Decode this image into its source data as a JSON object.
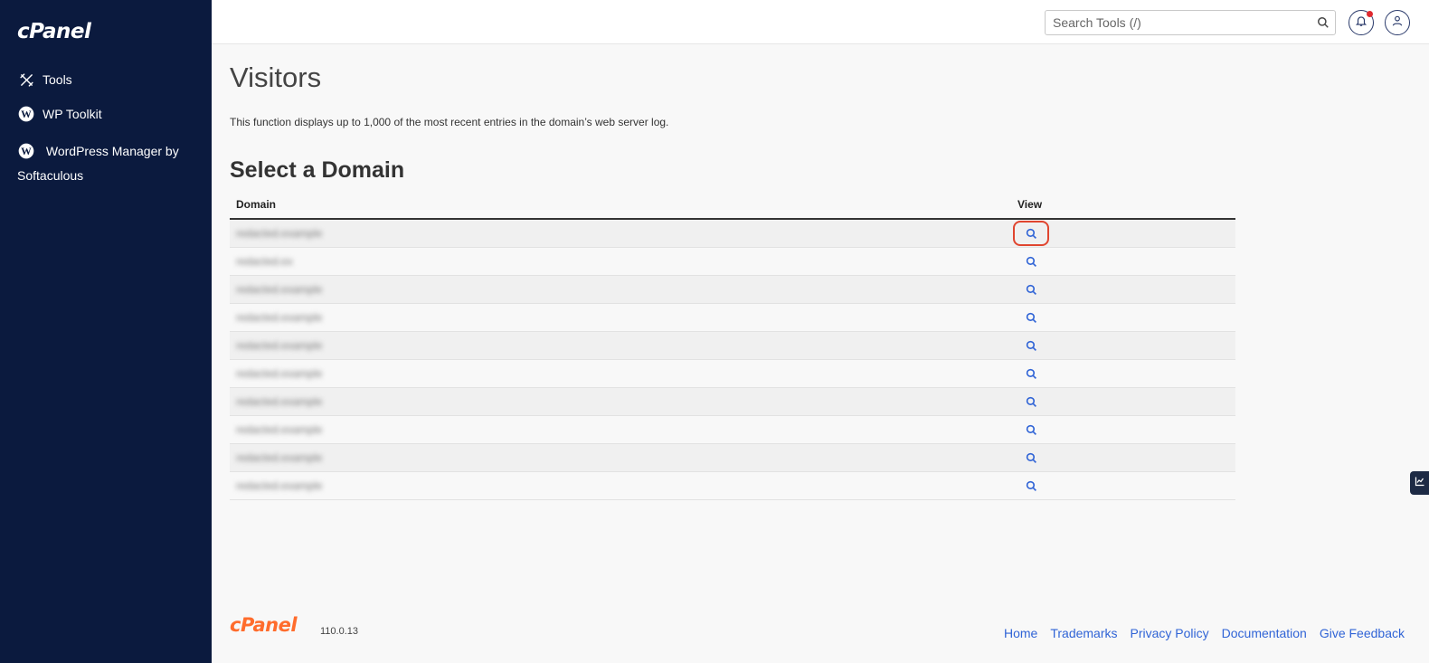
{
  "brand": {
    "logo_text": "cPanel",
    "version": "110.0.13"
  },
  "sidebar": {
    "items": [
      {
        "label": "Tools",
        "icon": "tools-icon"
      },
      {
        "label": "WP Toolkit",
        "icon": "wordpress-icon"
      },
      {
        "label": "WordPress Manager by Softaculous",
        "icon": "wordpress-icon"
      }
    ]
  },
  "header": {
    "search": {
      "placeholder": "Search Tools (/)"
    },
    "notification_icon": "bell-icon",
    "user_icon": "user-icon"
  },
  "main": {
    "title": "Visitors",
    "description": "This function displays up to 1,000 of the most recent entries in the domain’s web server log.",
    "section_title": "Select a Domain",
    "table": {
      "columns": [
        "Domain",
        "View"
      ],
      "rows": [
        {
          "domain": "redacted.example"
        },
        {
          "domain": "redacted.ex"
        },
        {
          "domain": "redacted.example"
        },
        {
          "domain": "redacted.example"
        },
        {
          "domain": "redacted.example"
        },
        {
          "domain": "redacted.example"
        },
        {
          "domain": "redacted.example"
        },
        {
          "domain": "redacted.example"
        },
        {
          "domain": "redacted.example"
        },
        {
          "domain": "redacted.example"
        }
      ],
      "view_icon": "search-icon"
    }
  },
  "footer": {
    "links": [
      "Home",
      "Trademarks",
      "Privacy Policy",
      "Documentation",
      "Give Feedback"
    ]
  },
  "colors": {
    "sidebar": "#0b1a3e",
    "accent": "#3064d6",
    "brand_orange": "#ff6c2c",
    "highlight": "#e0452f"
  }
}
